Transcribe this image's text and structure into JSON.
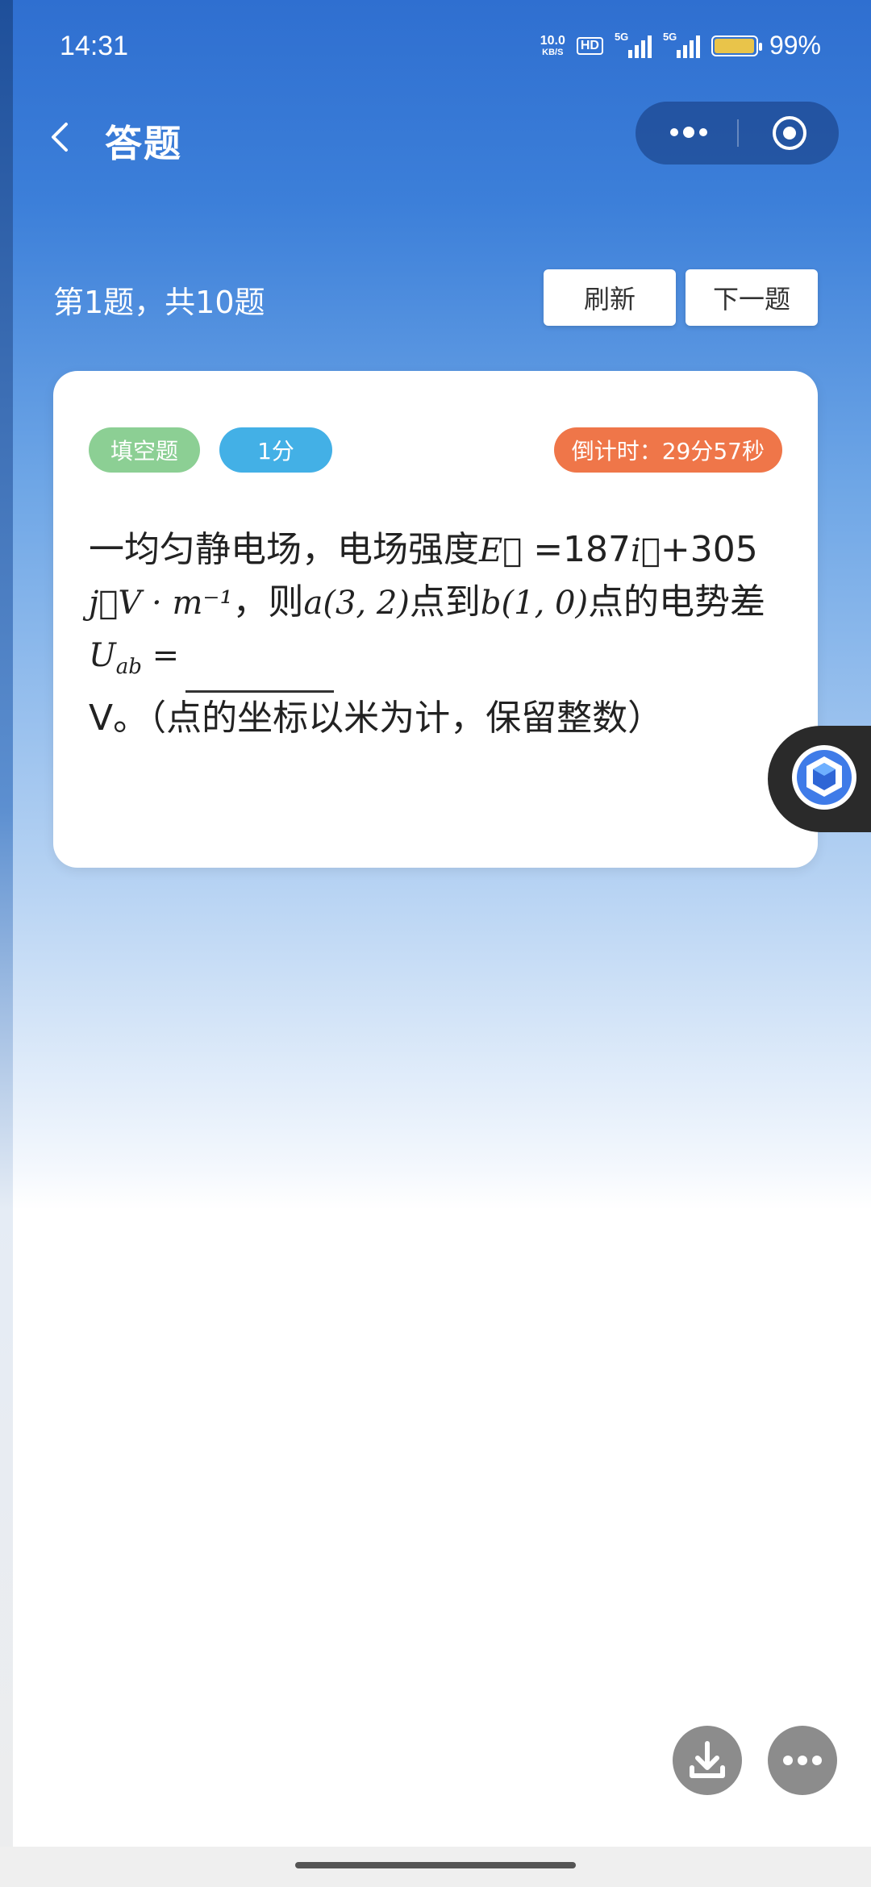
{
  "status_bar": {
    "time": "14:31",
    "net_speed_value": "10.0",
    "net_speed_unit": "KB/S",
    "hd_label": "HD",
    "sim1_tag": "5G",
    "sim2_tag": "5G",
    "battery_percent": "99%",
    "battery_level": 0.99,
    "battery_color": "#e9c44a"
  },
  "nav": {
    "title": "答题",
    "back_icon": "chevron-left-icon",
    "more_icon": "more-dots-icon",
    "close_icon": "target-circle-icon"
  },
  "progress": {
    "label": "第1题，共10题",
    "refresh_label": "刷新",
    "next_label": "下一题"
  },
  "question_card": {
    "type_tag": "填空题",
    "score_tag": "1分",
    "timer_label": "倒计时：29分57秒",
    "q_part1": "一均匀静电场，电场强度",
    "q_math_E": "E⃗",
    "q_eq1": " =187",
    "q_math_i": "i⃗",
    "q_plus": "+305",
    "q_math_j": "j⃗V · m⁻¹",
    "q_part2": "，则",
    "q_math_a": "a(3, 2)",
    "q_part3": "点到",
    "q_math_b": "b(1, 0)",
    "q_part4": "点的电势差",
    "q_math_U": "U",
    "q_math_U_sub": "ab",
    "q_math_eq": " =",
    "q_part5": "V。（点的坐标以米为计，保留整数）"
  },
  "colors": {
    "header_blue": "#2f6fd0",
    "tag_type": "#8ccf94",
    "tag_score": "#43b0e6",
    "tag_timer": "#ef7649"
  },
  "floating": {
    "assistant_icon": "cube-assistant-icon",
    "download_icon": "download-icon",
    "more_icon": "more-dots-icon"
  }
}
